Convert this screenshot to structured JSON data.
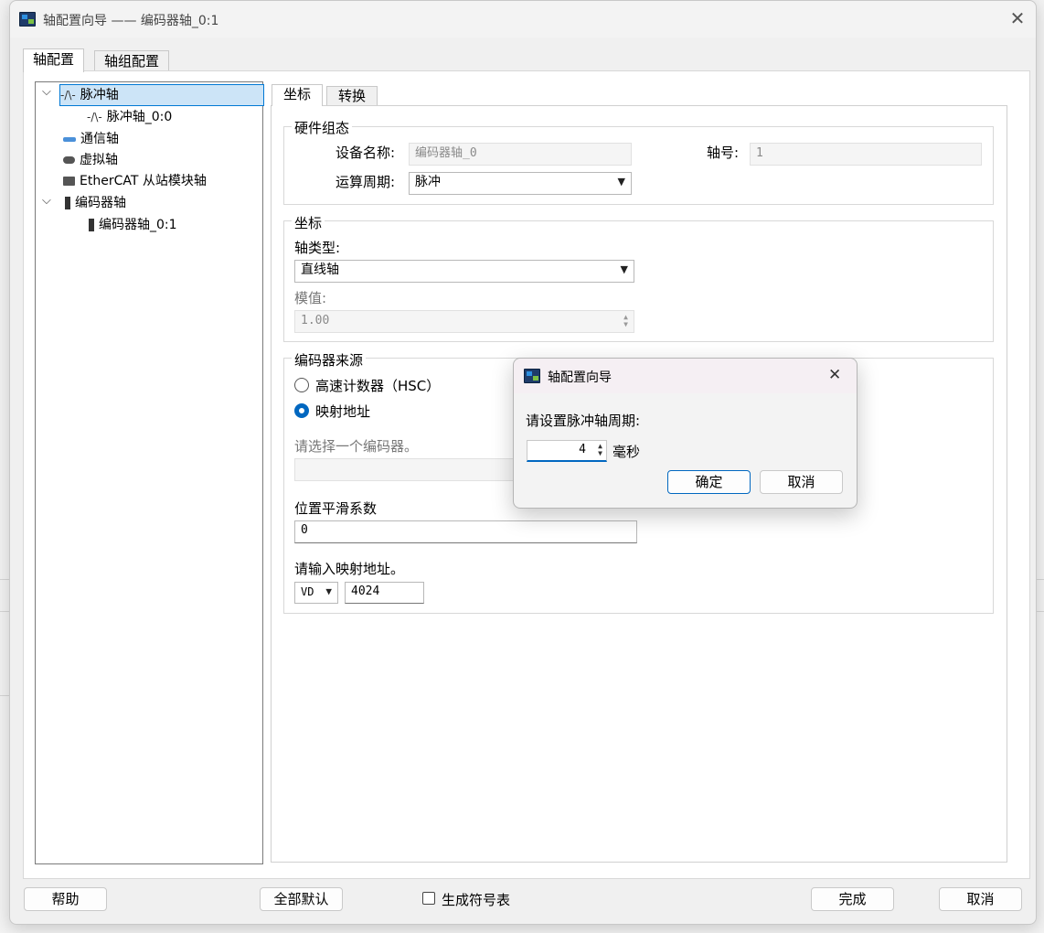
{
  "window": {
    "title": "轴配置向导 —— 编码器轴_0:1",
    "close_glyph": "✕"
  },
  "main_tabs": [
    {
      "label": "轴配置"
    },
    {
      "label": "轴组配置"
    }
  ],
  "tree": {
    "items": [
      {
        "label": "脉冲轴"
      },
      {
        "label": "脉冲轴_0:0"
      },
      {
        "label": "通信轴"
      },
      {
        "label": "虚拟轴"
      },
      {
        "label": "EtherCAT 从站模块轴"
      },
      {
        "label": "编码器轴"
      },
      {
        "label": "编码器轴_0:1"
      }
    ]
  },
  "sub_tabs": [
    {
      "label": "坐标"
    },
    {
      "label": "转换"
    }
  ],
  "hardware": {
    "title": "硬件组态",
    "device_name_label": "设备名称:",
    "device_name_value": "编码器轴_0",
    "axis_no_label": "轴号:",
    "axis_no_value": "1",
    "cycle_label": "运算周期:",
    "cycle_value": "脉冲"
  },
  "coordinate": {
    "title": "坐标",
    "axis_type_label": "轴类型:",
    "axis_type_value": "直线轴",
    "modulus_label": "模值:",
    "modulus_value": "1.00"
  },
  "encoder_source": {
    "title": "编码器来源",
    "option_hsc": "高速计数器（HSC）",
    "option_mapped": "映射地址",
    "selected": "映射地址",
    "select_encoder_hint": "请选择一个编码器。",
    "smooth_label": "位置平滑系数",
    "smooth_value": "0",
    "mapped_addr_label": "请输入映射地址。",
    "addr_type": "VD",
    "addr_value": "4024"
  },
  "footer": {
    "help": "帮助",
    "all_default": "全部默认",
    "gen_symbol": "生成符号表",
    "gen_symbol_checked": false,
    "finish": "完成",
    "cancel": "取消"
  },
  "modal": {
    "title": "轴配置向导",
    "prompt": "请设置脉冲轴周期:",
    "value": "4",
    "unit": "毫秒",
    "ok": "确定",
    "cancel": "取消",
    "close_glyph": "✕"
  },
  "colors": {
    "accent": "#0067c0",
    "selection": "#cce4f7"
  }
}
